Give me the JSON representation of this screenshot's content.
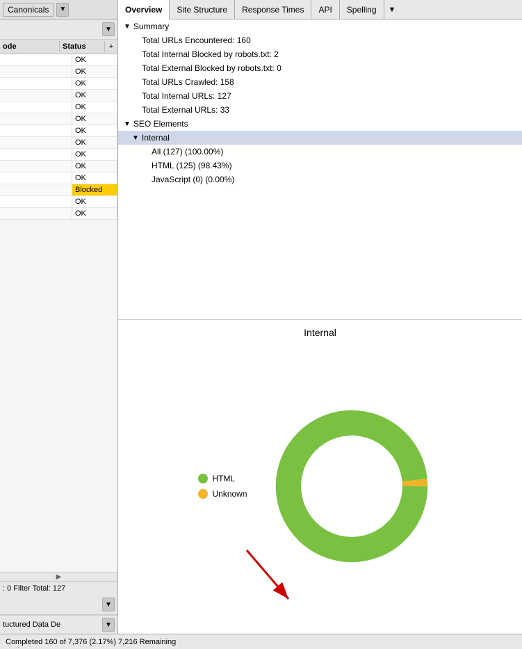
{
  "tabs": {
    "items": [
      {
        "label": "Overview",
        "active": true
      },
      {
        "label": "Site Structure",
        "active": false
      },
      {
        "label": "Response Times",
        "active": false
      },
      {
        "label": "API",
        "active": false
      },
      {
        "label": "Spelling",
        "active": false
      }
    ],
    "overflow_label": "▼"
  },
  "left_panel": {
    "header_label": "Canonicals",
    "dropdown_arrow": "▼",
    "columns": {
      "mode": "ode",
      "status": "Status",
      "plus": "+"
    },
    "rows": [
      {
        "mode": "",
        "status": "OK"
      },
      {
        "mode": "",
        "status": "OK"
      },
      {
        "mode": "",
        "status": "OK"
      },
      {
        "mode": "",
        "status": "OK"
      },
      {
        "mode": "",
        "status": "OK"
      },
      {
        "mode": "",
        "status": "OK"
      },
      {
        "mode": "",
        "status": "OK"
      },
      {
        "mode": "",
        "status": "OK"
      },
      {
        "mode": "",
        "status": "OK"
      },
      {
        "mode": "",
        "status": "OK"
      },
      {
        "mode": "",
        "status": "OK"
      },
      {
        "mode": "",
        "status": "Blocked"
      },
      {
        "mode": "",
        "status": "OK"
      },
      {
        "mode": "",
        "status": "OK"
      }
    ],
    "footer": ": 0 Filter Total: 127",
    "bottom_label": "tuctured Data De",
    "scroll_indicator": "▶"
  },
  "overview": {
    "summary_label": "Summary",
    "summary_arrow": "▼",
    "items": [
      {
        "label": "Total URLs Encountered: 160"
      },
      {
        "label": "Total Internal Blocked by robots.txt: 2"
      },
      {
        "label": "Total External Blocked by robots.txt: 0"
      },
      {
        "label": "Total URLs Crawled: 158"
      },
      {
        "label": "Total Internal URLs: 127"
      },
      {
        "label": "Total External URLs: 33"
      }
    ],
    "seo_elements_label": "SEO Elements",
    "seo_arrow": "▼",
    "internal_label": "Internal",
    "internal_arrow": "▼",
    "internal_items": [
      {
        "label": "All (127) (100.00%)"
      },
      {
        "label": "HTML (125) (98.43%)"
      },
      {
        "label": "JavaScript (0) (0.00%)"
      }
    ]
  },
  "chart": {
    "title": "Internal",
    "legend": [
      {
        "label": "HTML",
        "color": "#7ac142"
      },
      {
        "label": "Unknown",
        "color": "#f0b429"
      }
    ],
    "donut": {
      "html_percent": 98.43,
      "unknown_percent": 1.57,
      "html_color": "#7ac142",
      "unknown_color": "#f0b429",
      "bg_color": "#ffffff"
    }
  },
  "status_bar": {
    "text": "Completed 160 of 7,376 (2.17%) 7,216 Remaining"
  },
  "colors": {
    "accent": "#3366cc",
    "ok_text": "#000000",
    "blocked_bg": "#ffcc00"
  }
}
